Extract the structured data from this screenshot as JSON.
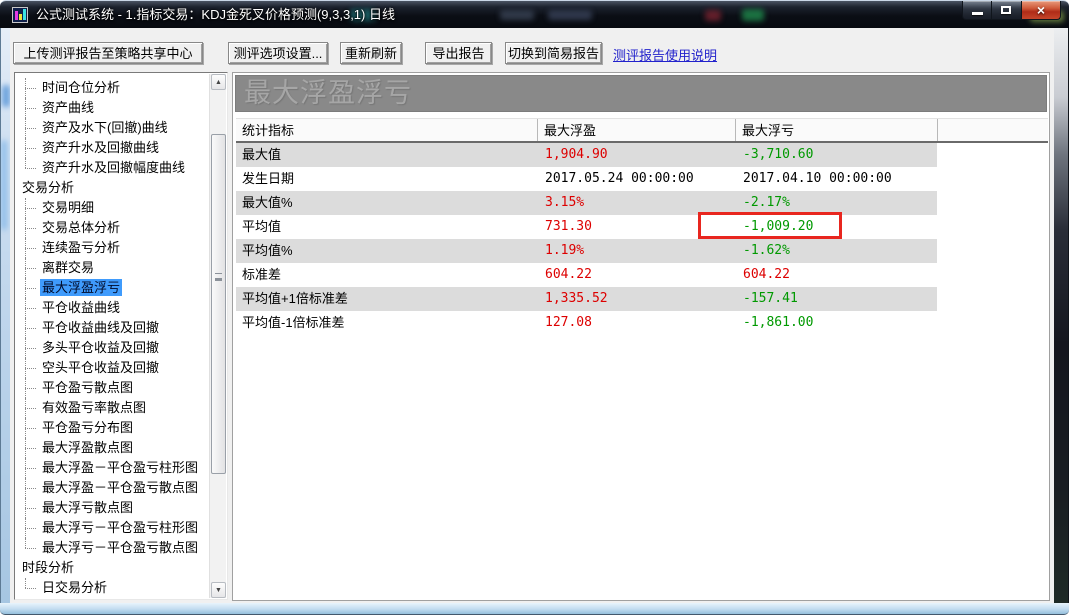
{
  "window": {
    "title": "公式测试系统 - 1.指标交易：KDJ金死叉价格预测(9,3,3,1) 日线",
    "control_icons": [
      "minimize-icon",
      "maximize-icon",
      "close-icon"
    ]
  },
  "toolbar": {
    "buttons": [
      {
        "name": "upload-report-button",
        "label": "上传测评报告至策略共享中心"
      },
      {
        "name": "options-button",
        "label": "测评选项设置..."
      },
      {
        "name": "refresh-button",
        "label": "重新刷新"
      },
      {
        "name": "export-report-button",
        "label": "导出报告"
      },
      {
        "name": "switch-simple-report-button",
        "label": "切换到简易报告"
      }
    ],
    "help_link": "测评报告使用说明"
  },
  "sidebar": {
    "items": [
      {
        "label": "时间仓位分析",
        "type": "child"
      },
      {
        "label": "资产曲线",
        "type": "child"
      },
      {
        "label": "资产及水下(回撤)曲线",
        "type": "child"
      },
      {
        "label": "资产升水及回撤曲线",
        "type": "child"
      },
      {
        "label": "资产升水及回撤幅度曲线",
        "type": "child"
      },
      {
        "label": "交易分析",
        "type": "section"
      },
      {
        "label": "交易明细",
        "type": "child"
      },
      {
        "label": "交易总体分析",
        "type": "child"
      },
      {
        "label": "连续盈亏分析",
        "type": "child"
      },
      {
        "label": "离群交易",
        "type": "child"
      },
      {
        "label": "最大浮盈浮亏",
        "type": "child",
        "selected": true
      },
      {
        "label": "平仓收益曲线",
        "type": "child"
      },
      {
        "label": "平仓收益曲线及回撤",
        "type": "child"
      },
      {
        "label": "多头平仓收益及回撤",
        "type": "child"
      },
      {
        "label": "空头平仓收益及回撤",
        "type": "child"
      },
      {
        "label": "平仓盈亏散点图",
        "type": "child"
      },
      {
        "label": "有效盈亏率散点图",
        "type": "child"
      },
      {
        "label": "平仓盈亏分布图",
        "type": "child"
      },
      {
        "label": "最大浮盈散点图",
        "type": "child"
      },
      {
        "label": "最大浮盈－平仓盈亏柱形图",
        "type": "child"
      },
      {
        "label": "最大浮盈－平仓盈亏散点图",
        "type": "child"
      },
      {
        "label": "最大浮亏散点图",
        "type": "child"
      },
      {
        "label": "最大浮亏－平仓盈亏柱形图",
        "type": "child"
      },
      {
        "label": "最大浮亏－平仓盈亏散点图",
        "type": "child"
      },
      {
        "label": "时段分析",
        "type": "section"
      },
      {
        "label": "日交易分析",
        "type": "child"
      }
    ]
  },
  "main": {
    "section_title": "最大浮盈浮亏",
    "table": {
      "columns": [
        "统计指标",
        "最大浮盈",
        "最大浮亏"
      ],
      "rows": [
        {
          "label": "最大值",
          "profit": "1,904.90",
          "profit_color": "red",
          "loss": "-3,710.60",
          "loss_color": "green"
        },
        {
          "label": "发生日期",
          "profit": "2017.05.24 00:00:00",
          "profit_color": "black",
          "loss": "2017.04.10 00:00:00",
          "loss_color": "black"
        },
        {
          "label": "最大值%",
          "profit": "3.15%",
          "profit_color": "red",
          "loss": "-2.17%",
          "loss_color": "green"
        },
        {
          "label": "平均值",
          "profit": "731.30",
          "profit_color": "red",
          "loss": "-1,009.20",
          "loss_color": "green",
          "loss_highlighted": true
        },
        {
          "label": "平均值%",
          "profit": "1.19%",
          "profit_color": "red",
          "loss": "-1.62%",
          "loss_color": "green"
        },
        {
          "label": "标准差",
          "profit": "604.22",
          "profit_color": "red",
          "loss": "604.22",
          "loss_color": "red"
        },
        {
          "label": "平均值+1倍标准差",
          "profit": "1,335.52",
          "profit_color": "red",
          "loss": "-157.41",
          "loss_color": "green"
        },
        {
          "label": "平均值-1倍标准差",
          "profit": "127.08",
          "profit_color": "red",
          "loss": "-1,861.00",
          "loss_color": "green"
        }
      ]
    }
  },
  "colors": {
    "profit_red": "#dd0000",
    "loss_green": "#009900",
    "value_black": "#000000",
    "highlight_box": "#e8261f",
    "selection_blue": "#3f9bfc",
    "link_blue": "#2222cc"
  }
}
